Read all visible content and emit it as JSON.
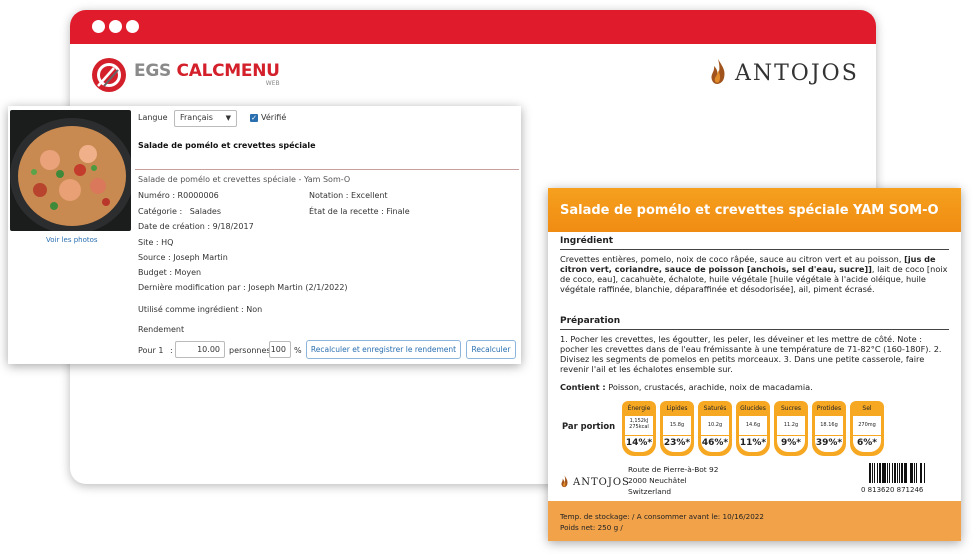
{
  "browser": {
    "brand": {
      "name_part1": "EGS ",
      "name_part2": "CALCMENU",
      "sub": "WEB"
    },
    "client_brand": "ANTOJOS",
    "colors": {
      "window_bar": "#e01b2b",
      "label_accent": "#f08c12"
    }
  },
  "recipe": {
    "photo_link": "Voir les photos",
    "language_label": "Langue",
    "language_value": "Français",
    "verified_label": "Vérifié",
    "short_title": "Salade de pomélo et crevettes spéciale",
    "full_title": "Salade de pomélo et crevettes spéciale - Yam Som-O",
    "number": "Numéro : R0000006",
    "rating": "Notation : Excellent",
    "category_label": "Catégorie :",
    "category_value": "Salades",
    "status": "État de la recette : Finale",
    "created": "Date de création : 9/18/2017",
    "site": "Site : HQ",
    "source": "Source : Joseph Martin",
    "budget": "Budget : Moyen",
    "modified": "Dernière modification par : Joseph Martin (2/1/2022)",
    "used_as_ingredient": "Utilisé comme ingrédient : Non",
    "yield_label": "Rendement",
    "per_label": "Pour 1",
    "colon": ":",
    "yield_value": "10.00",
    "persons_label": "personnes",
    "percent_value": "100",
    "percent_sign": "%",
    "btn_recalc_save": "Recalculer et enregistrer le rendement",
    "btn_recalc": "Recalculer"
  },
  "label": {
    "title": "Salade de pomélo et crevettes spéciale YAM SOM-O",
    "ingredient_title": "Ingrédient",
    "ingredient_part1": "Crevettes entières, pomelo, noix de coco râpée, sauce au citron vert et au poisson, ",
    "ingredient_bold": "[jus de citron vert, coriandre, sauce de poisson [anchois, sel d'eau, sucre]]",
    "ingredient_part2": ", lait de coco [noix de coco, eau], cacahuète, échalote, huile végétale [huile végétale à l'acide oléique, huile végétale raffinée, blanchie, déparaffinée et désodorisée], ail, piment écrasé.",
    "prep_title": "Préparation",
    "prep_text": "1. Pocher les crevettes, les égoutter, les peler, les déveiner et les mettre de côté. Note : pocher les crevettes dans de l'eau frémissante à une température de 71-82°C (160-180F). 2. Divisez les segments de pomelos en petits morceaux. 3. Dans une petite casserole, faire revenir l'ail et les échalotes ensemble sur.",
    "contains_label": "Contient :",
    "contains_value": "Poisson, crustacés, arachide, noix de macadamia.",
    "per_portion": "Par portion",
    "nutrients": [
      {
        "name": "Énergie",
        "value1": "1,152kJ",
        "value2": "275kcal",
        "pct": "14%*"
      },
      {
        "name": "Lipides",
        "value1": "15.8g",
        "value2": "",
        "pct": "23%*"
      },
      {
        "name": "Saturés",
        "value1": "10.2g",
        "value2": "",
        "pct": "46%*"
      },
      {
        "name": "Glucides",
        "value1": "14.6g",
        "value2": "",
        "pct": "11%*"
      },
      {
        "name": "Sucres",
        "value1": "11.2g",
        "value2": "",
        "pct": "9%*"
      },
      {
        "name": "Protides",
        "value1": "18.16g",
        "value2": "",
        "pct": "39%*"
      },
      {
        "name": "Sel",
        "value1": "270mg",
        "value2": "",
        "pct": "6%*"
      }
    ],
    "brand": "ANTOJOS",
    "address_line1": "Route de Pierre-à-Bot 92",
    "address_line2": "2000 Neuchâtel",
    "address_line3": "Switzerland",
    "barcode_digits": "0   813620   871246",
    "storage": "Temp. de stockage:   / A consommer avant le: 10/16/2022",
    "net_weight": "Poids net: 250 g /"
  }
}
